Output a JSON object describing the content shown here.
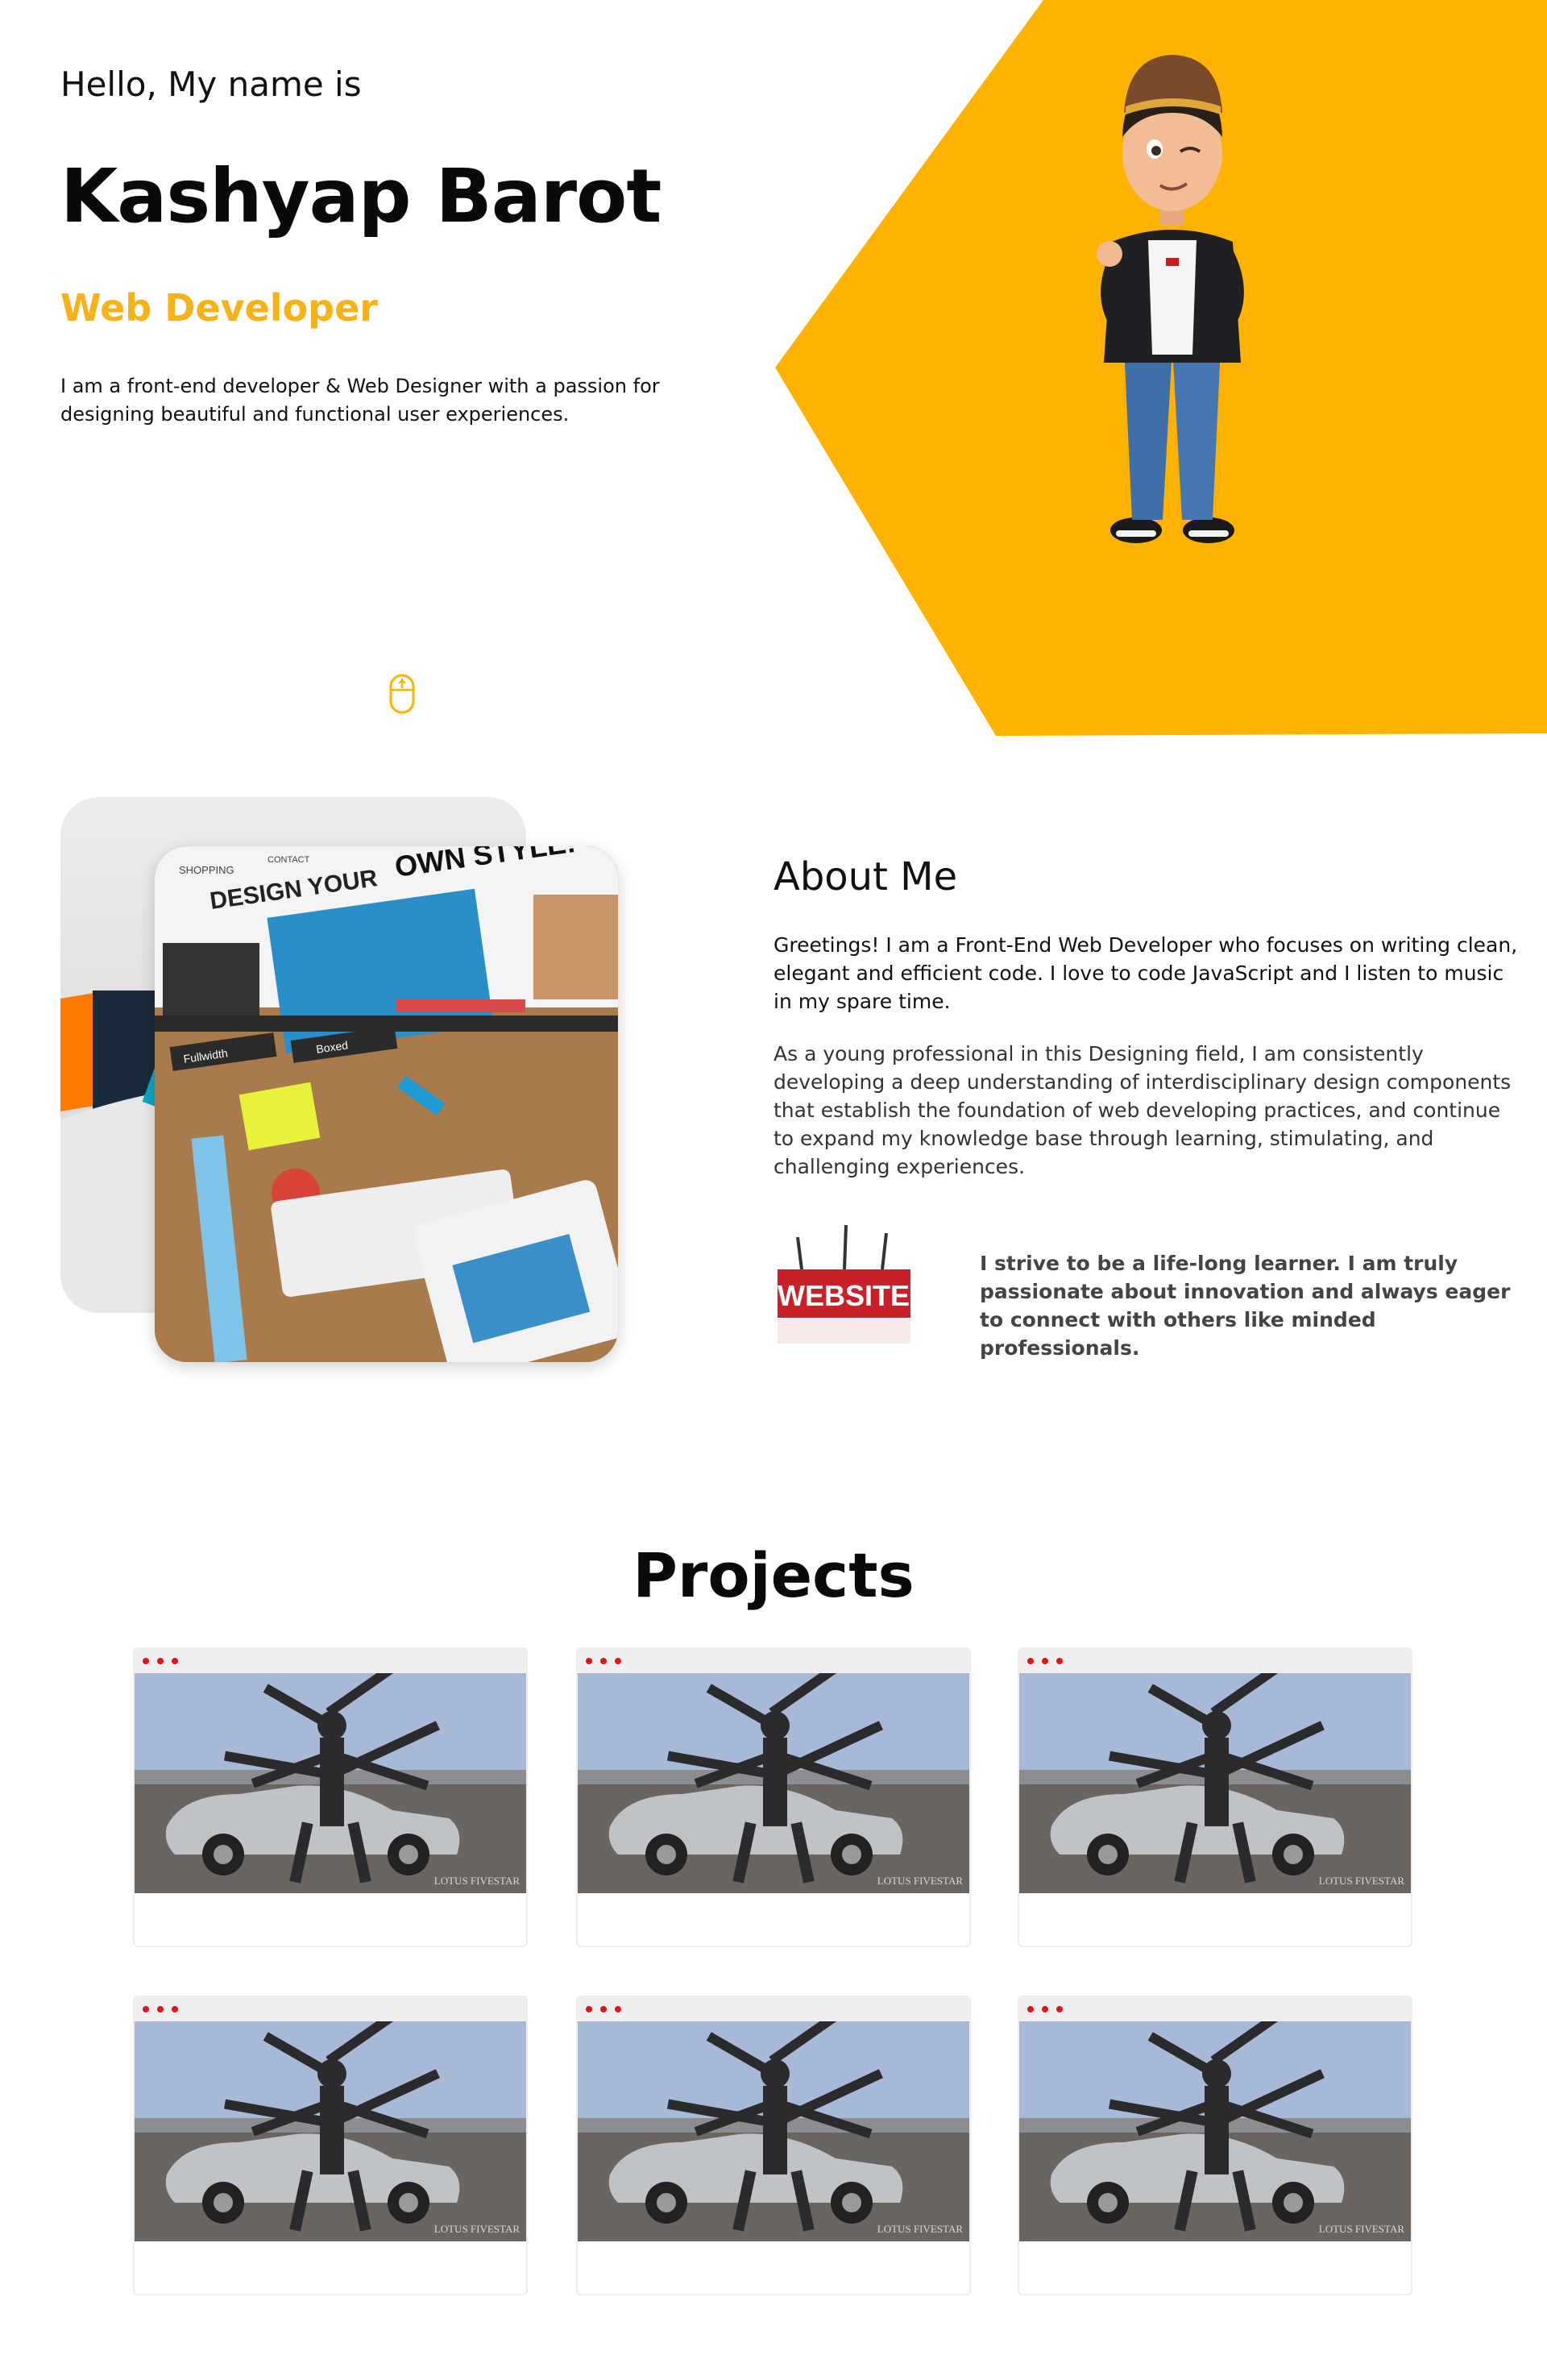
{
  "hero": {
    "greeting": "Hello, My name is",
    "name": "Kashyap Barot",
    "role": "Web Developer",
    "intro": "I am a front-end developer & Web Designer with a passion for designing beautiful and functional user experiences.",
    "accent_color": "#FFB300",
    "avatar_icon": "cartoon-avatar-image",
    "scroll_icon": "mouse-scroll-icon"
  },
  "about": {
    "heading": "About Me",
    "paragraph1": "Greetings! I am a Front-End Web Developer who focuses on writing clean, elegant and efficient code. I love to code JavaScript and I listen to music in my spare time.",
    "paragraph2": "As a young professional in this Designing field, I am consistently developing a deep understanding of interdisciplinary design components that establish the foundation of web developing practices, and continue to expand my knowledge base through learning, stimulating, and challenging experiences.",
    "highlight": "I strive to be a life-long learner. I am truly passionate about innovation and always eager to connect with others like minded professionals.",
    "image_text": {
      "shopping": "SHOPPING",
      "contact": "CONTACT",
      "design_your": "DESIGN YOUR",
      "own_style": "OWN STYLE!",
      "fullwidth": "Fullwidth",
      "boxed": "Boxed"
    },
    "logo_text": "WEBSITE"
  },
  "projects": {
    "title": "Projects",
    "watermark": "LOTUS FIVESTAR",
    "cards": [
      {
        "id": "project-1"
      },
      {
        "id": "project-2"
      },
      {
        "id": "project-3"
      },
      {
        "id": "project-4"
      },
      {
        "id": "project-5"
      },
      {
        "id": "project-6"
      }
    ],
    "dot_color": "#E41313"
  }
}
